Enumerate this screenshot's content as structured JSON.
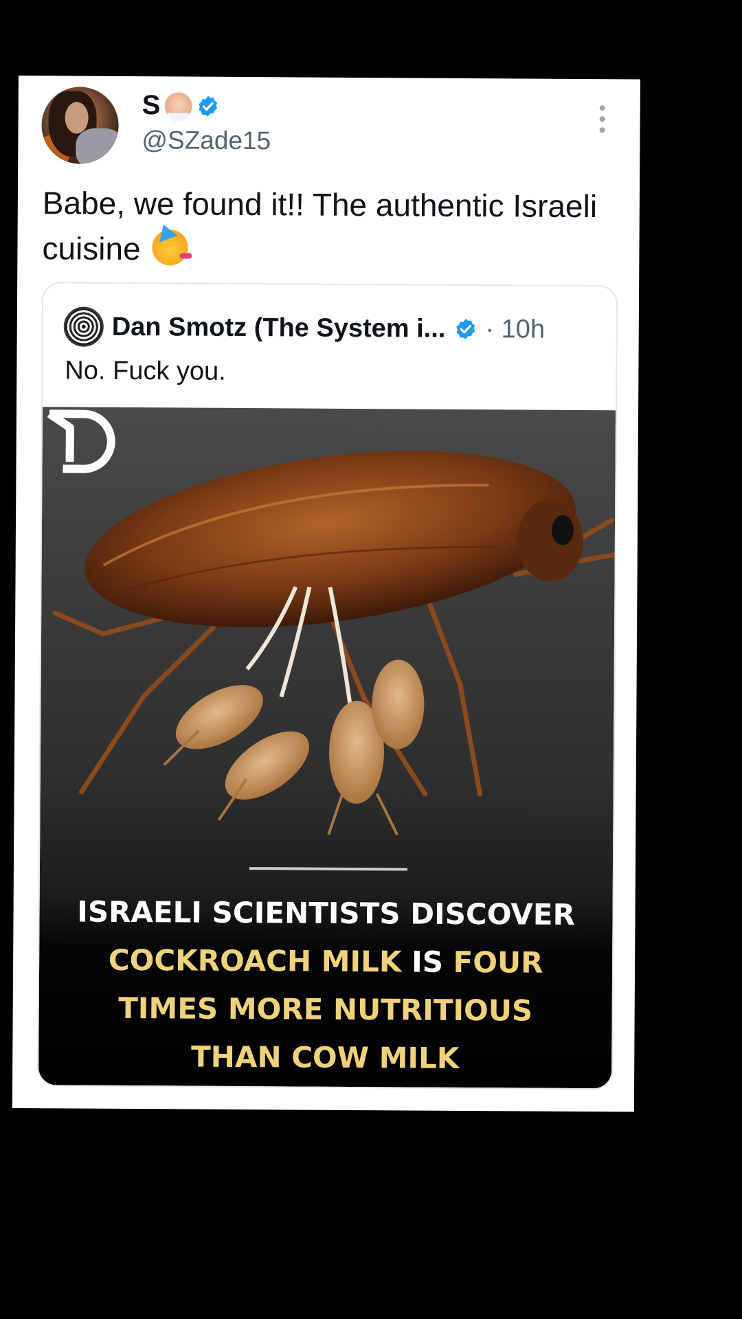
{
  "tweet": {
    "display_name": "S",
    "handle": "@SZade15",
    "text": "Babe, we found it!! The authentic Israeli cuisine",
    "icons": [
      "avatar",
      "baby-emoji-icon",
      "verified-badge-icon",
      "more-options-icon",
      "partying-face-emoji-icon"
    ]
  },
  "quoted": {
    "display_name": "Dan Smotz (The System i...",
    "time": "· 10h",
    "text": "No. Fuck you.",
    "image": {
      "description_icon": "cockroach-photo",
      "logo": "D-logo-icon",
      "headline": {
        "line1": "ISRAELI SCIENTISTS DISCOVER",
        "line2_part1": "COCKROACH MILK",
        "line2_part2": "IS",
        "line2_part3": "FOUR",
        "line3": "TIMES MORE NUTRITIOUS",
        "line4": "THAN COW MILK"
      }
    }
  },
  "colors": {
    "background": "#000000",
    "card": "#ffffff",
    "verified_blue": "#1d9bf0",
    "muted_text": "#536471",
    "headline_yellow": "#f0d27a"
  }
}
